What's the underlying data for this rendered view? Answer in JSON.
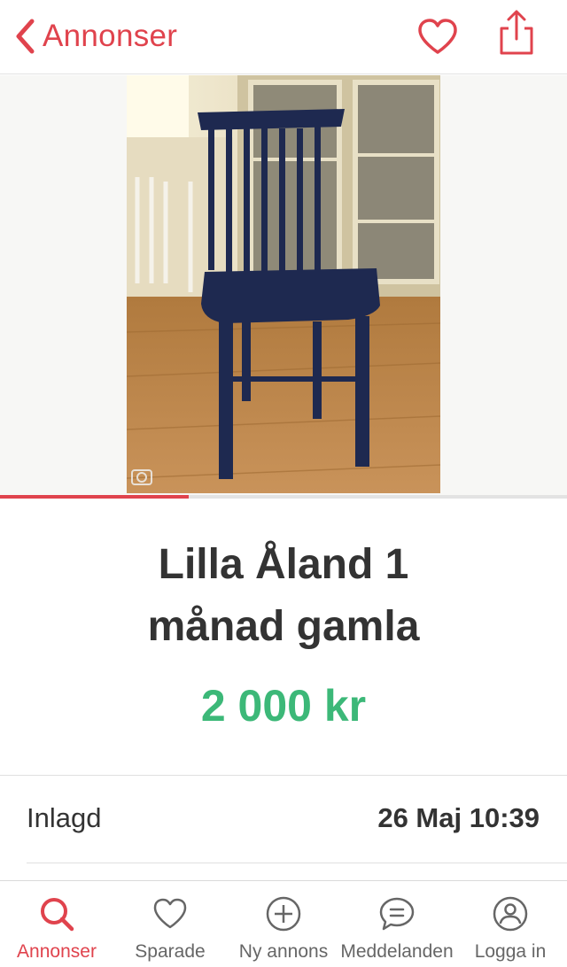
{
  "header": {
    "back_label": "Annonser",
    "accent_color": "#e0434d"
  },
  "gallery": {
    "image_alt": "Navy blue wooden spindle-back chair on wood floor in front of a glass cabinet",
    "progress_fraction": 0.333
  },
  "listing": {
    "title_line1": "Lilla Åland 1",
    "title_line2": "månad gamla",
    "price": "2 000 kr",
    "price_color": "#3cb878"
  },
  "details": [
    {
      "label": "Inlagd",
      "value": "26 Maj 10:39"
    }
  ],
  "tabbar": {
    "active": "Annonser",
    "tabs": [
      {
        "label": "Annonser",
        "icon": "search-icon"
      },
      {
        "label": "Sparade",
        "icon": "heart-icon"
      },
      {
        "label": "Ny annons",
        "icon": "plus-circle-icon"
      },
      {
        "label": "Meddelanden",
        "icon": "message-icon"
      },
      {
        "label": "Logga in",
        "icon": "user-icon"
      }
    ]
  }
}
